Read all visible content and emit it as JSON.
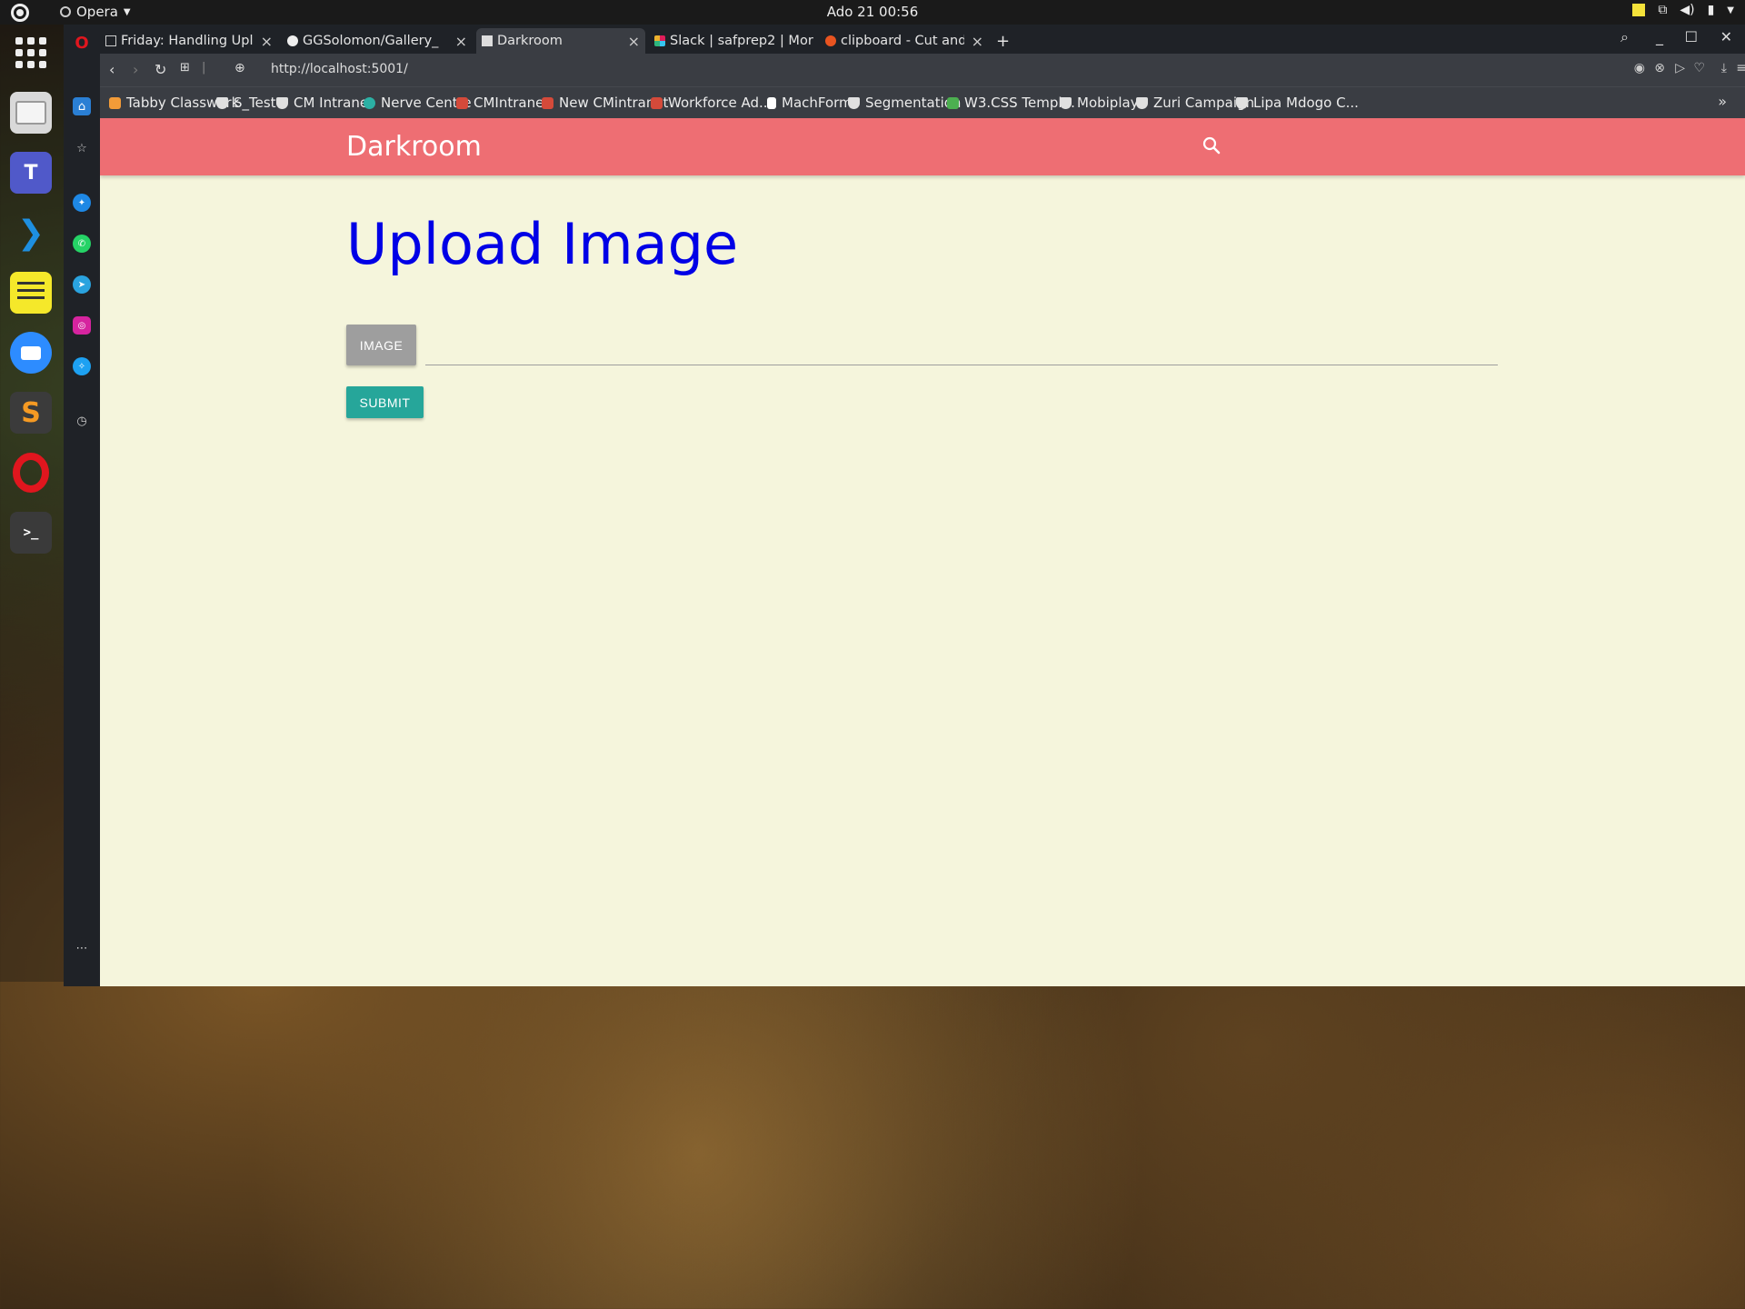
{
  "system": {
    "app_name": "Opera",
    "clock": "Ado 21  00:56"
  },
  "browser": {
    "tabs": [
      {
        "label": "Friday: Handling Uplo",
        "active": false,
        "icon": "doc-icon"
      },
      {
        "label": "GGSolomon/Gallery_",
        "active": false,
        "icon": "github-icon"
      },
      {
        "label": "Darkroom",
        "active": true,
        "icon": "doc-icon"
      },
      {
        "label": "Slack | safprep2 | Mor",
        "active": false,
        "icon": "slack-icon"
      },
      {
        "label": "clipboard - Cut and C",
        "active": false,
        "icon": "askubuntu-icon"
      }
    ],
    "new_tab": "+",
    "url": "http://localhost:5001/",
    "bookmarks": [
      {
        "label": "Tabby Classwork",
        "color": "#f29b38"
      },
      {
        "label": "S_Test",
        "color": "#e0e0e0"
      },
      {
        "label": "CM Intranet",
        "color": "#e0e0e0"
      },
      {
        "label": "Nerve Centre",
        "color": "#2bb0a4"
      },
      {
        "label": "CMIntranet",
        "color": "#d44a3a"
      },
      {
        "label": "New CMintranet",
        "color": "#d44a3a"
      },
      {
        "label": "Workforce Ad...",
        "color": "#d44a3a"
      },
      {
        "label": "MachForm",
        "color": "#ffffff"
      },
      {
        "label": "Segmentation",
        "color": "#e0e0e0"
      },
      {
        "label": "W3.CSS Templ...",
        "color": "#4caf50"
      },
      {
        "label": "Mobiplay",
        "color": "#e0e0e0"
      },
      {
        "label": "Zuri Campaign",
        "color": "#e0e0e0"
      },
      {
        "label": "Lipa Mdogo C...",
        "color": "#e0e0e0"
      }
    ],
    "bookmarks_more": "»"
  },
  "page": {
    "brand": "Darkroom",
    "heading": "Upload Image",
    "image_button": "IMAGE",
    "file_path_value": "",
    "submit_button": "SUBMIT",
    "colors": {
      "navbar": "#ee6e73",
      "background": "#f5f5dc",
      "heading": "#0000e6",
      "submit": "#26a69a",
      "image_button": "#9e9e9e"
    }
  },
  "dock": [
    {
      "name": "app-grid-icon"
    },
    {
      "name": "files-icon"
    },
    {
      "name": "teams-icon"
    },
    {
      "name": "vscode-icon"
    },
    {
      "name": "notes-icon"
    },
    {
      "name": "zoom-icon"
    },
    {
      "name": "sublime-icon"
    },
    {
      "name": "opera-icon"
    },
    {
      "name": "terminal-icon"
    }
  ],
  "opera_sidebar": [
    {
      "name": "home-icon"
    },
    {
      "name": "bookmarks-icon"
    },
    {
      "name": "messenger-icon"
    },
    {
      "name": "whatsapp-icon"
    },
    {
      "name": "telegram-icon"
    },
    {
      "name": "instagram-icon"
    },
    {
      "name": "twitter-icon"
    },
    {
      "name": "history-icon"
    },
    {
      "name": "more-icon"
    }
  ]
}
